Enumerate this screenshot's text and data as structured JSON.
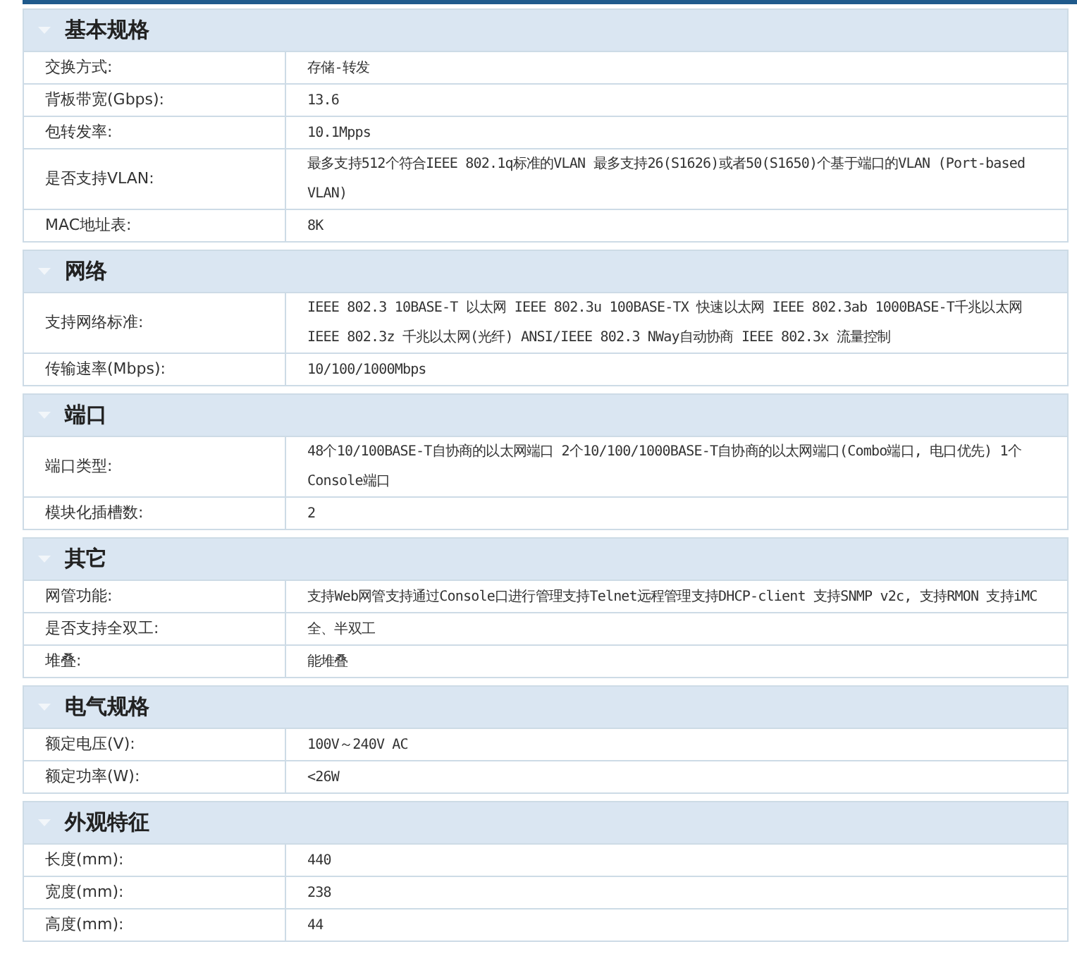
{
  "sections": [
    {
      "title": "基本规格",
      "expanded": true,
      "rows": [
        {
          "label": "交换方式:",
          "value": "存储-转发"
        },
        {
          "label": "背板带宽(Gbps):",
          "value": "13.6"
        },
        {
          "label": "包转发率:",
          "value": "10.1Mpps"
        },
        {
          "label": "是否支持VLAN:",
          "value": "最多支持512个符合IEEE 802.1q标准的VLAN 最多支持26(S1626)或者50(S1650)个基于端口的VLAN (Port-based VLAN)"
        },
        {
          "label": "MAC地址表:",
          "value": "8K"
        }
      ]
    },
    {
      "title": "网络",
      "expanded": true,
      "rows": [
        {
          "label": "支持网络标准:",
          "value": "IEEE 802.3 10BASE-T 以太网 IEEE 802.3u 100BASE-TX 快速以太网 IEEE 802.3ab 1000BASE-T千兆以太网 IEEE 802.3z 千兆以太网(光纤) ANSI/IEEE 802.3 NWay自动协商 IEEE 802.3x 流量控制"
        },
        {
          "label": "传输速率(Mbps):",
          "value": "10/100/1000Mbps"
        }
      ]
    },
    {
      "title": "端口",
      "expanded": true,
      "rows": [
        {
          "label": "端口类型:",
          "value": "48个10/100BASE-T自协商的以太网端口 2个10/100/1000BASE-T自协商的以太网端口(Combo端口, 电口优先) 1个Console端口"
        },
        {
          "label": "模块化插槽数:",
          "value": "2"
        }
      ]
    },
    {
      "title": "其它",
      "expanded": true,
      "rows": [
        {
          "label": "网管功能:",
          "value": "支持Web网管支持通过Console口进行管理支持Telnet远程管理支持DHCP-client 支持SNMP v2c, 支持RMON 支持iMC"
        },
        {
          "label": "是否支持全双工:",
          "value": "全、半双工"
        },
        {
          "label": "堆叠:",
          "value": "能堆叠"
        }
      ]
    },
    {
      "title": "电气规格",
      "expanded": true,
      "rows": [
        {
          "label": "额定电压(V):",
          "value": "100V～240V AC"
        },
        {
          "label": "额定功率(W):",
          "value": "<26W"
        }
      ]
    },
    {
      "title": "外观特征",
      "expanded": true,
      "rows": [
        {
          "label": "长度(mm):",
          "value": "440"
        },
        {
          "label": "宽度(mm):",
          "value": "238"
        },
        {
          "label": "高度(mm):",
          "value": "44"
        }
      ]
    }
  ]
}
